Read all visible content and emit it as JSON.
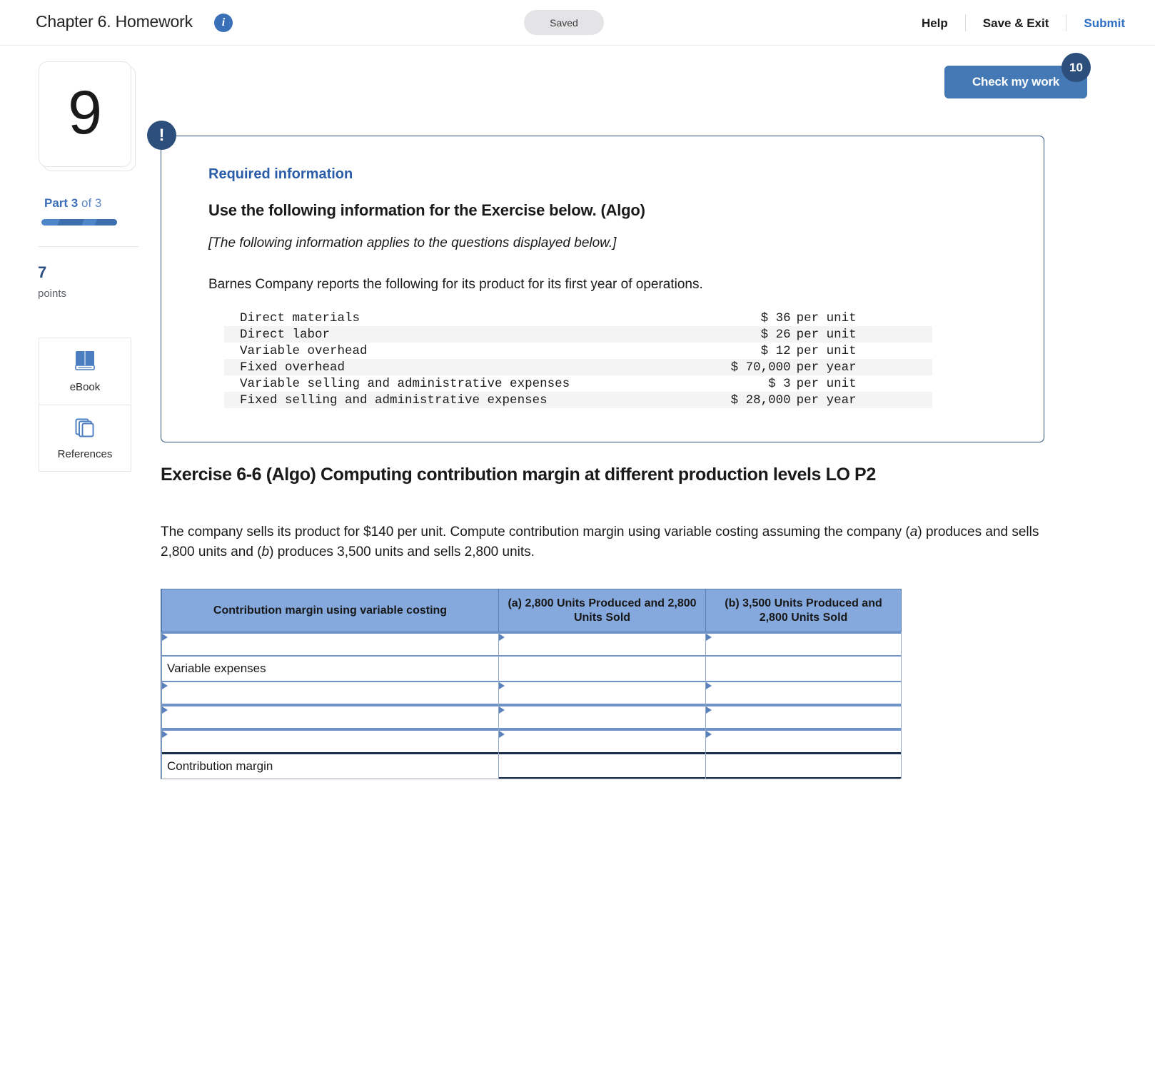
{
  "topbar": {
    "title": "Chapter 6. Homework",
    "info_icon": "info-icon",
    "saved_label": "Saved",
    "help_label": "Help",
    "save_exit_label": "Save & Exit",
    "submit_label": "Submit"
  },
  "sidebar": {
    "question_number": "9",
    "part_prefix": "Part ",
    "part_current": "3",
    "part_suffix": " of 3",
    "points_value": "7",
    "points_label": "points",
    "tools": [
      {
        "name": "ebook",
        "label": "eBook",
        "icon": "book-icon"
      },
      {
        "name": "references",
        "label": "References",
        "icon": "copy-pages-icon"
      }
    ]
  },
  "main": {
    "check_button_label": "Check my work",
    "check_badge_count": "10",
    "required_box": {
      "alert_icon": "exclamation-icon",
      "kicker": "Required information",
      "heading": "Use the following information for the Exercise below. (Algo)",
      "italic_note": "[The following information applies to the questions displayed below.]",
      "paragraph": "Barnes Company reports the following for its product for its first year of operations.",
      "cost_rows": [
        {
          "label": "Direct materials",
          "amount": "$ 36",
          "per": "per unit"
        },
        {
          "label": "Direct labor",
          "amount": "$ 26",
          "per": "per unit"
        },
        {
          "label": "Variable overhead",
          "amount": "$ 12",
          "per": "per unit"
        },
        {
          "label": "Fixed overhead",
          "amount": "$ 70,000",
          "per": "per year"
        },
        {
          "label": "Variable selling and administrative expenses",
          "amount": "$ 3",
          "per": "per unit"
        },
        {
          "label": "Fixed selling and administrative expenses",
          "amount": "$ 28,000",
          "per": "per year"
        }
      ]
    },
    "exercise_title": "Exercise 6-6 (Algo) Computing contribution margin at different production levels LO P2",
    "exercise_desc_1": "The company sells its product for $140 per unit. Compute contribution margin using variable costing assuming the company (",
    "exercise_desc_a": "a",
    "exercise_desc_2": ") produces and sells 2,800 units and (",
    "exercise_desc_b": "b",
    "exercise_desc_3": ") produces 3,500 units and sells 2,800 units.",
    "answer_table": {
      "headers": [
        "Contribution margin using variable costing",
        "(a) 2,800 Units Produced and 2,800 Units Sold",
        "(b) 3,500 Units Produced and 2,800 Units Sold"
      ],
      "rows": [
        {
          "label": "",
          "type": "input",
          "col_a": "",
          "col_b": ""
        },
        {
          "label": "Variable expenses",
          "type": "static",
          "col_a": "",
          "col_b": ""
        },
        {
          "label": "",
          "type": "input",
          "col_a": "",
          "col_b": ""
        },
        {
          "label": "",
          "type": "input",
          "col_a": "",
          "col_b": ""
        },
        {
          "label": "",
          "type": "input",
          "col_a": "",
          "col_b": ""
        },
        {
          "label": "Contribution margin",
          "type": "total",
          "col_a": "",
          "col_b": ""
        }
      ]
    }
  }
}
